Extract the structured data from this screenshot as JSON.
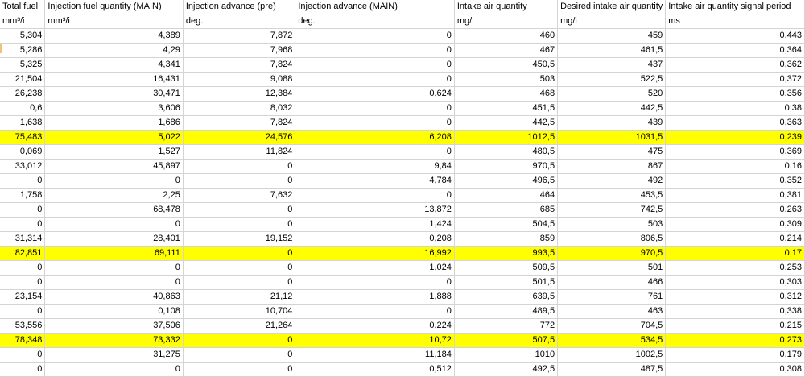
{
  "sheet": {
    "headers": [
      "Total fuel",
      "Injection fuel quantity (MAIN)",
      "Injection advance (pre)",
      "Injection advance (MAIN)",
      "Intake air quantity",
      "Desired intake air quantity",
      "Intake air quantity signal period"
    ],
    "units": [
      "mm³/i",
      "mm³/i",
      "deg.",
      "deg.",
      "mg/i",
      "mg/i",
      "ms"
    ],
    "highlight_color": "#ffff00",
    "rows": [
      {
        "cells": [
          "5,304",
          "4,389",
          "7,872",
          "0",
          "460",
          "459",
          "0,443"
        ],
        "highlight": false
      },
      {
        "cells": [
          "5,286",
          "4,29",
          "7,968",
          "0",
          "467",
          "461,5",
          "0,364"
        ],
        "highlight": false
      },
      {
        "cells": [
          "5,325",
          "4,341",
          "7,824",
          "0",
          "450,5",
          "437",
          "0,362"
        ],
        "highlight": false
      },
      {
        "cells": [
          "21,504",
          "16,431",
          "9,088",
          "0",
          "503",
          "522,5",
          "0,372"
        ],
        "highlight": false
      },
      {
        "cells": [
          "26,238",
          "30,471",
          "12,384",
          "0,624",
          "468",
          "520",
          "0,356"
        ],
        "highlight": false
      },
      {
        "cells": [
          "0,6",
          "3,606",
          "8,032",
          "0",
          "451,5",
          "442,5",
          "0,38"
        ],
        "highlight": false
      },
      {
        "cells": [
          "1,638",
          "1,686",
          "7,824",
          "0",
          "442,5",
          "439",
          "0,363"
        ],
        "highlight": false
      },
      {
        "cells": [
          "75,483",
          "5,022",
          "24,576",
          "6,208",
          "1012,5",
          "1031,5",
          "0,239"
        ],
        "highlight": true
      },
      {
        "cells": [
          "0,069",
          "1,527",
          "11,824",
          "0",
          "480,5",
          "475",
          "0,369"
        ],
        "highlight": false
      },
      {
        "cells": [
          "33,012",
          "45,897",
          "0",
          "9,84",
          "970,5",
          "867",
          "0,16"
        ],
        "highlight": false
      },
      {
        "cells": [
          "0",
          "0",
          "0",
          "4,784",
          "496,5",
          "492",
          "0,352"
        ],
        "highlight": false
      },
      {
        "cells": [
          "1,758",
          "2,25",
          "7,632",
          "0",
          "464",
          "453,5",
          "0,381"
        ],
        "highlight": false
      },
      {
        "cells": [
          "0",
          "68,478",
          "0",
          "13,872",
          "685",
          "742,5",
          "0,263"
        ],
        "highlight": false
      },
      {
        "cells": [
          "0",
          "0",
          "0",
          "1,424",
          "504,5",
          "503",
          "0,309"
        ],
        "highlight": false
      },
      {
        "cells": [
          "31,314",
          "28,401",
          "19,152",
          "0,208",
          "859",
          "806,5",
          "0,214"
        ],
        "highlight": false
      },
      {
        "cells": [
          "82,851",
          "69,111",
          "0",
          "16,992",
          "993,5",
          "970,5",
          "0,17"
        ],
        "highlight": true
      },
      {
        "cells": [
          "0",
          "0",
          "0",
          "1,024",
          "509,5",
          "501",
          "0,253"
        ],
        "highlight": false
      },
      {
        "cells": [
          "0",
          "0",
          "0",
          "0",
          "501,5",
          "466",
          "0,303"
        ],
        "highlight": false
      },
      {
        "cells": [
          "23,154",
          "40,863",
          "21,12",
          "1,888",
          "639,5",
          "761",
          "0,312"
        ],
        "highlight": false
      },
      {
        "cells": [
          "0",
          "0,108",
          "10,704",
          "0",
          "489,5",
          "463",
          "0,338"
        ],
        "highlight": false
      },
      {
        "cells": [
          "53,556",
          "37,506",
          "21,264",
          "0,224",
          "772",
          "704,5",
          "0,215"
        ],
        "highlight": false
      },
      {
        "cells": [
          "78,348",
          "73,332",
          "0",
          "10,72",
          "507,5",
          "534,5",
          "0,273"
        ],
        "highlight": true
      },
      {
        "cells": [
          "0",
          "31,275",
          "0",
          "11,184",
          "1010",
          "1002,5",
          "0,179"
        ],
        "highlight": false
      },
      {
        "cells": [
          "0",
          "0",
          "0",
          "0,512",
          "492,5",
          "487,5",
          "0,308"
        ],
        "highlight": false
      }
    ]
  }
}
